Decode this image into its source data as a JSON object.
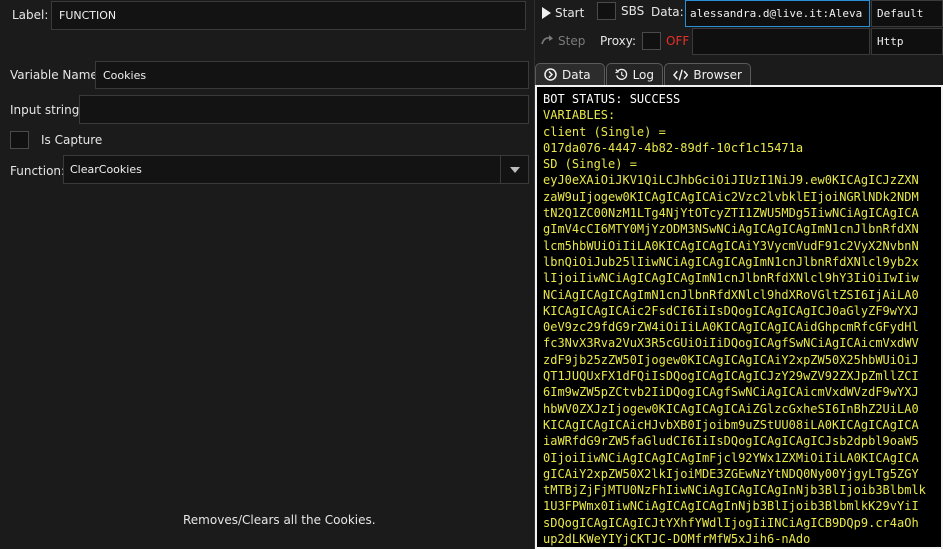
{
  "left_panel": {
    "label_caption": "Label:",
    "label_value": "FUNCTION",
    "variable_name_caption": "Variable Name:",
    "variable_name_value": "Cookies",
    "input_string_caption": "Input string:",
    "input_string_value": "",
    "is_capture_caption": "Is Capture",
    "is_capture_checked": false,
    "function_caption": "Function:",
    "function_value": "ClearCookies",
    "description": "Removes/Clears all the Cookies."
  },
  "toolbar": {
    "start_label": "Start",
    "step_label": "Step",
    "sbs_label": "SBS",
    "sbs_checked": false,
    "data_caption": "Data:",
    "data_value": "alessandra.d@live.it:Aleva",
    "config_value": "Default",
    "proxy_caption": "Proxy:",
    "proxy_state": "OFF",
    "proxy_type": "Http",
    "colors": {
      "proxy_off": "#e8312a"
    }
  },
  "tabs": [
    {
      "label": "Data",
      "icon": "circle-arrow-icon"
    },
    {
      "label": "Log",
      "icon": "history-icon"
    },
    {
      "label": "Browser",
      "icon": "code-icon"
    }
  ],
  "console": {
    "colors": {
      "status": "#ffffff",
      "variables": "#e8e84a"
    },
    "lines": [
      {
        "text": "BOT STATUS: SUCCESS",
        "color": "white"
      },
      {
        "text": "VARIABLES:",
        "color": "yellow"
      },
      {
        "text": "client (Single) =",
        "color": "yellow"
      },
      {
        "text": "017da076-4447-4b82-89df-10cf1c15471a",
        "color": "yellow"
      },
      {
        "text": "SD (Single) =",
        "color": "yellow"
      },
      {
        "text": "eyJ0eXAiOiJKV1QiLCJhbGciOiJIUzI1NiJ9.ew0KICAgICJzZXN",
        "color": "yellow"
      },
      {
        "text": "zaW9uIjogew0KICAgICAgICAic2Vzc2lvbklEIjoiNGRlNDk2NDM",
        "color": "yellow"
      },
      {
        "text": "tN2Q1ZC00NzM1LTg4NjYtOTcyZTI1ZWU5MDg5IiwNCiAgICAgICA",
        "color": "yellow"
      },
      {
        "text": "gImV4cCI6MTY0MjYzODM3NSwNCiAgICAgICAgImN1cnJlbnRfdXN",
        "color": "yellow"
      },
      {
        "text": "lcm5hbWUiOiIiLA0KICAgICAgICAiY3VycmVudF91c2VyX2NvbnN",
        "color": "yellow"
      },
      {
        "text": "lbnQiOiJub25lIiwNCiAgICAgICAgImN1cnJlbnRfdXNlcl9yb2x",
        "color": "yellow"
      },
      {
        "text": "lIjoiIiwNCiAgICAgICAgImN1cnJlbnRfdXNlcl9hY3IiOiIwIiw",
        "color": "yellow"
      },
      {
        "text": "NCiAgICAgICAgImN1cnJlbnRfdXNlcl9hdXRoVGltZSI6IjAiLA0",
        "color": "yellow"
      },
      {
        "text": "KICAgICAgICAic2FsdCI6IiIsDQogICAgICAgICJ0aGlyZF9wYXJ",
        "color": "yellow"
      },
      {
        "text": "0eV9zc29fdG9rZW4iOiIiLA0KICAgICAgICAidGhpcmRfcGFydHl",
        "color": "yellow"
      },
      {
        "text": "fc3NvX3Rva2VuX3R5cGUiOiIiDQogICAgfSwNCiAgICAicmVxdWV",
        "color": "yellow"
      },
      {
        "text": "zdF9jb25zZW50Ijogew0KICAgICAgICAiY2xpZW50X25hbWUiOiJ",
        "color": "yellow"
      },
      {
        "text": "QT1JUQUxFX1dFQiIsDQogICAgICAgICJzY29wZV92ZXJpZmllZCI",
        "color": "yellow"
      },
      {
        "text": "6Im9wZW5pZCtvb2IiDQogICAgfSwNCiAgICAicmVxdWVzdF9wYXJ",
        "color": "yellow"
      },
      {
        "text": "hbWV0ZXJzIjogew0KICAgICAgICAiZGlzcGxheSI6InBhZ2UiLA0",
        "color": "yellow"
      },
      {
        "text": "KICAgICAgICAicHJvbXB0Ijoibm9uZStUU08iLA0KICAgICAgICA",
        "color": "yellow"
      },
      {
        "text": "iaWRfdG9rZW5faGludCI6IiIsDQogICAgICAgICJsb2dpbl9oaW5",
        "color": "yellow"
      },
      {
        "text": "0IjoiIiwNCiAgICAgICAgImFjcl92YWx1ZXMiOiIiLA0KICAgICA",
        "color": "yellow"
      },
      {
        "text": "gICAiY2xpZW50X2lkIjoiMDE3ZGEwNzYtNDQ0Ny00YjgyLTg5ZGY",
        "color": "yellow"
      },
      {
        "text": "tMTBjZjFjMTU0NzFhIiwNCiAgICAgICAgInNjb3BlIjoib3Blbmlk",
        "color": "yellow"
      },
      {
        "text": "1U3FPWmx0IiwNCiAgICAgICAgInNjb3BlIjoib3BlbmlkK29vYiI",
        "color": "yellow"
      },
      {
        "text": "sDQogICAgICAgICJtYXhfYWdlIjogIiINCiAgICB9DQp9.cr4aOh",
        "color": "yellow"
      },
      {
        "text": "up2dLKWeYIYjCKTJC-DOMfrMfW5xJih6-nAdo",
        "color": "yellow"
      }
    ]
  }
}
